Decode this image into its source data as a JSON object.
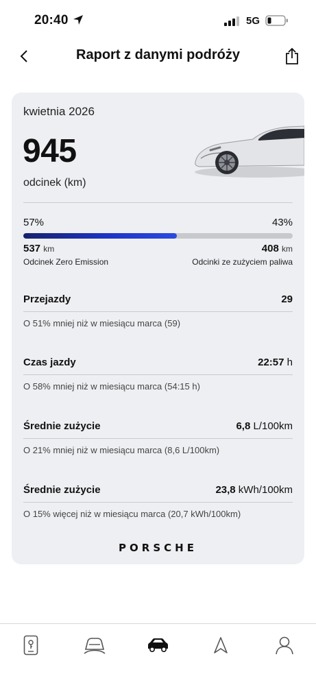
{
  "status_bar": {
    "time": "20:40",
    "network": "5G"
  },
  "nav": {
    "title": "Raport z danymi podróży",
    "back_icon": "chevron-left-icon",
    "share_icon": "share-icon"
  },
  "report": {
    "month": "kwietnia 2026",
    "total_distance": "945",
    "total_unit": "odcinek (km)",
    "split": {
      "electric_percent_label": "57%",
      "fuel_percent_label": "43%",
      "electric_fraction": 0.57,
      "electric_km": "537",
      "fuel_km": "408",
      "km_unit": "km",
      "electric_label": "Odcinek Zero Emission",
      "fuel_label": "Odcinki ze zużyciem paliwa"
    },
    "stats": [
      {
        "label": "Przejazdy",
        "value": "29",
        "unit": "",
        "note": "O 51% mniej niż w miesiącu marca (59)"
      },
      {
        "label": "Czas jazdy",
        "value": "22:57",
        "unit": " h",
        "note": "O 58% mniej niż w miesiącu marca (54:15 h)"
      },
      {
        "label": "Średnie zużycie",
        "value": "6,8",
        "unit": " L/100km",
        "note": "O 21% mniej niż w miesiącu marca (8,6 L/100km)"
      },
      {
        "label": "Średnie zużycie",
        "value": "23,8",
        "unit": " kWh/100km",
        "note": "O 15% więcej niż w miesiącu marca (20,7 kWh/100km)"
      }
    ],
    "brand": "PORSCHE"
  },
  "tabbar": {
    "tabs": [
      {
        "icon": "phone-key-icon"
      },
      {
        "icon": "car-service-icon"
      },
      {
        "icon": "car-icon",
        "active": true
      },
      {
        "icon": "navigation-arrow-icon"
      },
      {
        "icon": "profile-icon"
      }
    ]
  },
  "colors": {
    "accent_bar": "#1e34c6",
    "card_bg": "#eeeff2"
  }
}
